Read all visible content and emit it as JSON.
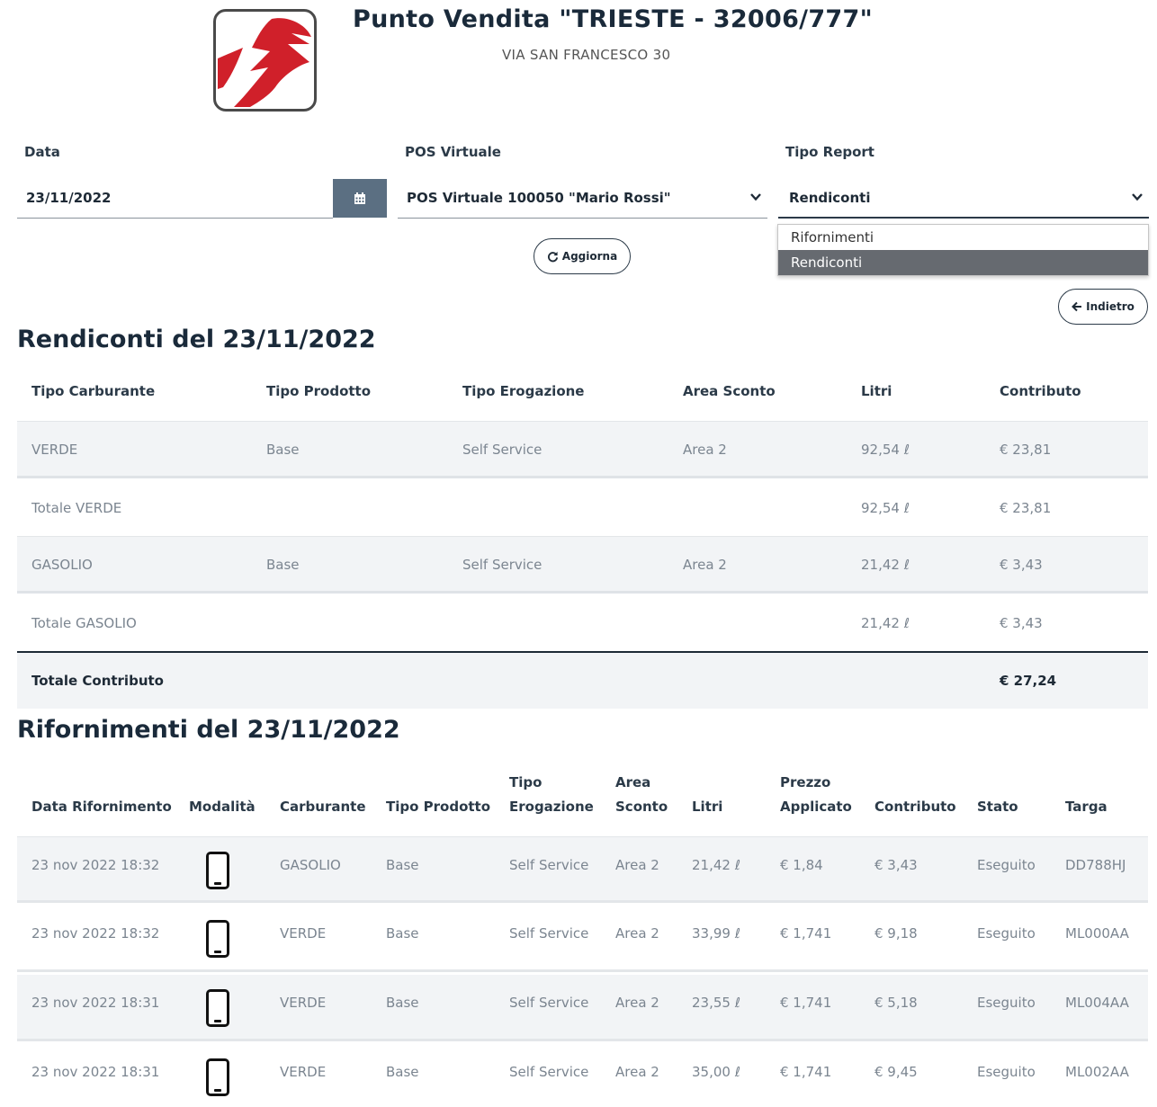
{
  "header": {
    "title": "Punto Vendita \"TRIESTE - 32006/777\"",
    "address": "VIA SAN FRANCESCO 30"
  },
  "filters": {
    "data_label": "Data",
    "data_value": "23/11/2022",
    "pos_label": "POS Virtuale",
    "pos_value": "POS Virtuale 100050 \"Mario Rossi\"",
    "tipo_label": "Tipo Report",
    "tipo_value": "Rendiconti",
    "tipo_options": [
      "Rifornimenti",
      "Rendiconti"
    ]
  },
  "buttons": {
    "aggiorna": "Aggiorna",
    "indietro": "Indietro"
  },
  "rendiconti": {
    "title": "Rendiconti del 23/11/2022",
    "headers": [
      "Tipo Carburante",
      "Tipo Prodotto",
      "Tipo Erogazione",
      "Area Sconto",
      "Litri",
      "Contributo"
    ],
    "rows": [
      [
        "VERDE",
        "Base",
        "Self Service",
        "Area 2",
        "92,54 ℓ",
        "€ 23,81"
      ],
      [
        "Totale VERDE",
        "",
        "",
        "",
        "92,54 ℓ",
        "€ 23,81"
      ],
      [
        "GASOLIO",
        "Base",
        "Self Service",
        "Area 2",
        "21,42 ℓ",
        "€ 3,43"
      ],
      [
        "Totale GASOLIO",
        "",
        "",
        "",
        "21,42 ℓ",
        "€ 3,43"
      ]
    ],
    "total_label": "Totale Contributo",
    "total_value": "€ 27,24"
  },
  "rifornimenti": {
    "title": "Rifornimenti del 23/11/2022",
    "headers": [
      [
        "Data Rifornimento"
      ],
      [
        "Modalità"
      ],
      [
        "Carburante"
      ],
      [
        "Tipo Prodotto"
      ],
      [
        "Tipo",
        "Erogazione"
      ],
      [
        "Area",
        "Sconto"
      ],
      [
        "Litri"
      ],
      [
        "Prezzo",
        "Applicato"
      ],
      [
        "Contributo"
      ],
      [
        "Stato"
      ],
      [
        "Targa"
      ]
    ],
    "rows": [
      [
        "23 nov 2022 18:32",
        "phone-icon",
        "GASOLIO",
        "Base",
        "Self Service",
        "Area 2",
        "21,42 ℓ",
        "€ 1,84",
        "€ 3,43",
        "Eseguito",
        "DD788HJ"
      ],
      [
        "23 nov 2022 18:32",
        "phone-icon",
        "VERDE",
        "Base",
        "Self Service",
        "Area 2",
        "33,99 ℓ",
        "€ 1,741",
        "€ 9,18",
        "Eseguito",
        "ML000AA"
      ],
      [
        "23 nov 2022 18:31",
        "phone-icon",
        "VERDE",
        "Base",
        "Self Service",
        "Area 2",
        "23,55 ℓ",
        "€ 1,741",
        "€ 5,18",
        "Eseguito",
        "ML004AA"
      ],
      [
        "23 nov 2022 18:31",
        "phone-icon",
        "VERDE",
        "Base",
        "Self Service",
        "Area 2",
        "35,00 ℓ",
        "€ 1,741",
        "€ 9,45",
        "Eseguito",
        "ML002AA"
      ]
    ]
  },
  "colors": {
    "brand_red": "#d0202a",
    "calendar_button": "#5b6f82",
    "selected_option": "#666a70"
  }
}
